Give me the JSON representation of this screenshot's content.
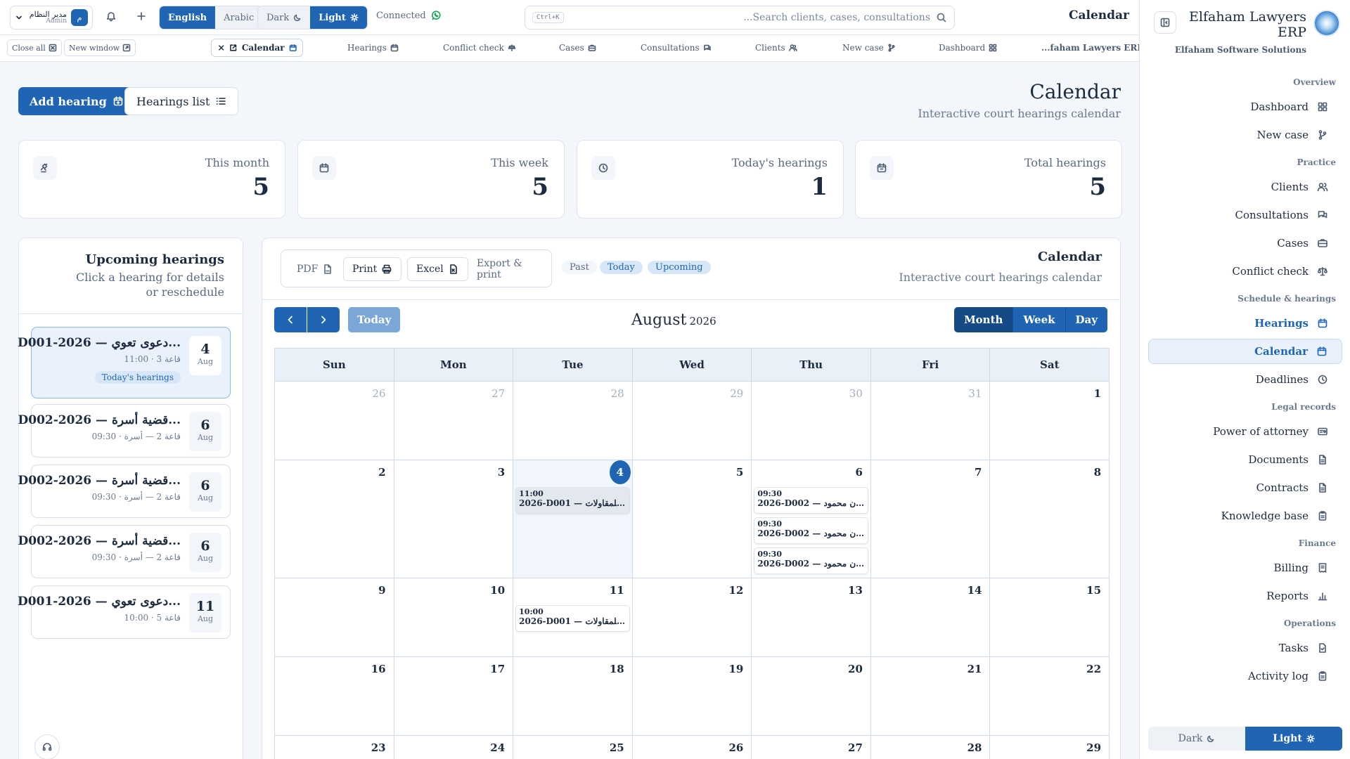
{
  "topbar": {
    "user_name": "مدير النظام",
    "user_role": "Admin",
    "user_initial": "م",
    "lang_english": "English",
    "lang_arabic": "Arabic",
    "theme_dark": "Dark",
    "theme_light": "Light",
    "connection": "Connected",
    "search_shortcut": "Ctrl+K",
    "search_placeholder": "...Search clients, cases, consultations",
    "title": "Calendar"
  },
  "tabstrip": {
    "close_all": "Close all",
    "new_window": "New window",
    "active_tab": "Calendar",
    "tabs": [
      "Hearings",
      "Conflict check",
      "Cases",
      "Consultations",
      "Clients",
      "New case",
      "Dashboard",
      "...faham Lawyers ERP"
    ]
  },
  "page": {
    "add_hearing": "Add hearing",
    "hearings_list": "Hearings list",
    "title": "Calendar",
    "subtitle": "Interactive court hearings calendar"
  },
  "stats": [
    {
      "label": "This month",
      "value": "5"
    },
    {
      "label": "This week",
      "value": "5"
    },
    {
      "label": "Today's hearings",
      "value": "1"
    },
    {
      "label": "Total hearings",
      "value": "5"
    }
  ],
  "upcoming": {
    "title": "Upcoming hearings",
    "subtitle": "Click a hearing for details or reschedule",
    "items": [
      {
        "title": "D001-2026 — دعوى تعوي...",
        "sub": "11:00 · قاعة 3",
        "badge": "Today's hearings",
        "day": "4",
        "month": "Aug"
      },
      {
        "title": "D002-2026 — قضية أسرة...",
        "sub": "09:30 · قاعة 2 — أسرة",
        "day": "6",
        "month": "Aug"
      },
      {
        "title": "D002-2026 — قضية أسرة...",
        "sub": "09:30 · قاعة 2 — أسرة",
        "day": "6",
        "month": "Aug"
      },
      {
        "title": "D002-2026 — قضية أسرة...",
        "sub": "09:30 · قاعة 2 — أسرة",
        "day": "6",
        "month": "Aug"
      },
      {
        "title": "D001-2026 — دعوى تعوي...",
        "sub": "10:00 · قاعة 5",
        "day": "11",
        "month": "Aug"
      }
    ]
  },
  "calendar": {
    "title": "Calendar",
    "subtitle": "Interactive court hearings calendar",
    "export": {
      "pdf": "PDF",
      "print": "Print",
      "excel": "Excel",
      "export_print": "Export & print"
    },
    "filters": {
      "past": "Past",
      "today": "Today",
      "upcoming": "Upcoming"
    },
    "today_button": "Today",
    "month": "August",
    "year": "2026",
    "views": {
      "month": "Month",
      "week": "Week",
      "day": "Day"
    },
    "weekdays": [
      "Sun",
      "Mon",
      "Tue",
      "Wed",
      "Thu",
      "Fri",
      "Sat"
    ],
    "weeks": [
      [
        {
          "d": "26",
          "out": true
        },
        {
          "d": "27",
          "out": true
        },
        {
          "d": "28",
          "out": true
        },
        {
          "d": "29",
          "out": true
        },
        {
          "d": "30",
          "out": true
        },
        {
          "d": "31",
          "out": true
        },
        {
          "d": "1"
        }
      ],
      [
        {
          "d": "2"
        },
        {
          "d": "3"
        },
        {
          "d": "4",
          "today": true,
          "events": [
            {
              "time": "11:00",
              "name": "2026-D001 — دلتا للمقاولات...",
              "hl": true
            }
          ]
        },
        {
          "d": "5"
        },
        {
          "d": "6",
          "events": [
            {
              "time": "09:30",
              "name": "2026-D002 — رهان محمود..."
            },
            {
              "time": "09:30",
              "name": "2026-D002 — رهان محمود..."
            },
            {
              "time": "09:30",
              "name": "2026-D002 — رهان محمود..."
            }
          ]
        },
        {
          "d": "7"
        },
        {
          "d": "8"
        }
      ],
      [
        {
          "d": "9"
        },
        {
          "d": "10"
        },
        {
          "d": "11",
          "events": [
            {
              "time": "10:00",
              "name": "2026-D001 — دلتا للمقاولات..."
            }
          ]
        },
        {
          "d": "12"
        },
        {
          "d": "13"
        },
        {
          "d": "14"
        },
        {
          "d": "15"
        }
      ],
      [
        {
          "d": "16"
        },
        {
          "d": "17"
        },
        {
          "d": "18"
        },
        {
          "d": "19"
        },
        {
          "d": "20"
        },
        {
          "d": "21"
        },
        {
          "d": "22"
        }
      ],
      [
        {
          "d": "23"
        },
        {
          "d": "24"
        },
        {
          "d": "25"
        },
        {
          "d": "26"
        },
        {
          "d": "27"
        },
        {
          "d": "28"
        },
        {
          "d": "29"
        }
      ]
    ]
  },
  "sidebar": {
    "brand": "Elfaham Lawyers ERP",
    "brand_sub": "Elfaham Software Solutions",
    "groups": [
      {
        "label": "Overview",
        "items": [
          {
            "label": "Dashboard",
            "icon": "grid-icon"
          },
          {
            "label": "New case",
            "icon": "branch-icon"
          }
        ]
      },
      {
        "label": "Practice",
        "items": [
          {
            "label": "Clients",
            "icon": "users-icon"
          },
          {
            "label": "Consultations",
            "icon": "chat-icon"
          },
          {
            "label": "Cases",
            "icon": "briefcase-icon"
          },
          {
            "label": "Conflict check",
            "icon": "scale-icon"
          }
        ]
      },
      {
        "label": "Schedule & hearings",
        "items": [
          {
            "label": "Hearings",
            "icon": "calendar-icon"
          },
          {
            "label": "Calendar",
            "icon": "calendar-icon"
          },
          {
            "label": "Deadlines",
            "icon": "clock-icon"
          }
        ]
      },
      {
        "label": "Legal records",
        "items": [
          {
            "label": "Power of attorney",
            "icon": "card-icon"
          },
          {
            "label": "Documents",
            "icon": "file-icon"
          },
          {
            "label": "Contracts",
            "icon": "file-icon"
          },
          {
            "label": "Knowledge base",
            "icon": "clipboard-icon"
          }
        ]
      },
      {
        "label": "Finance",
        "items": [
          {
            "label": "Billing",
            "icon": "receipt-icon"
          },
          {
            "label": "Reports",
            "icon": "bar-chart-icon"
          }
        ]
      },
      {
        "label": "Operations",
        "items": [
          {
            "label": "Tasks",
            "icon": "task-icon"
          },
          {
            "label": "Activity log",
            "icon": "clipboard-icon"
          }
        ]
      }
    ],
    "theme_dark": "Dark",
    "theme_light": "Light"
  },
  "colors": {
    "accent": "#1f65b4",
    "whatsapp": "#1da35a",
    "active_bg": "#e9f2fc"
  }
}
